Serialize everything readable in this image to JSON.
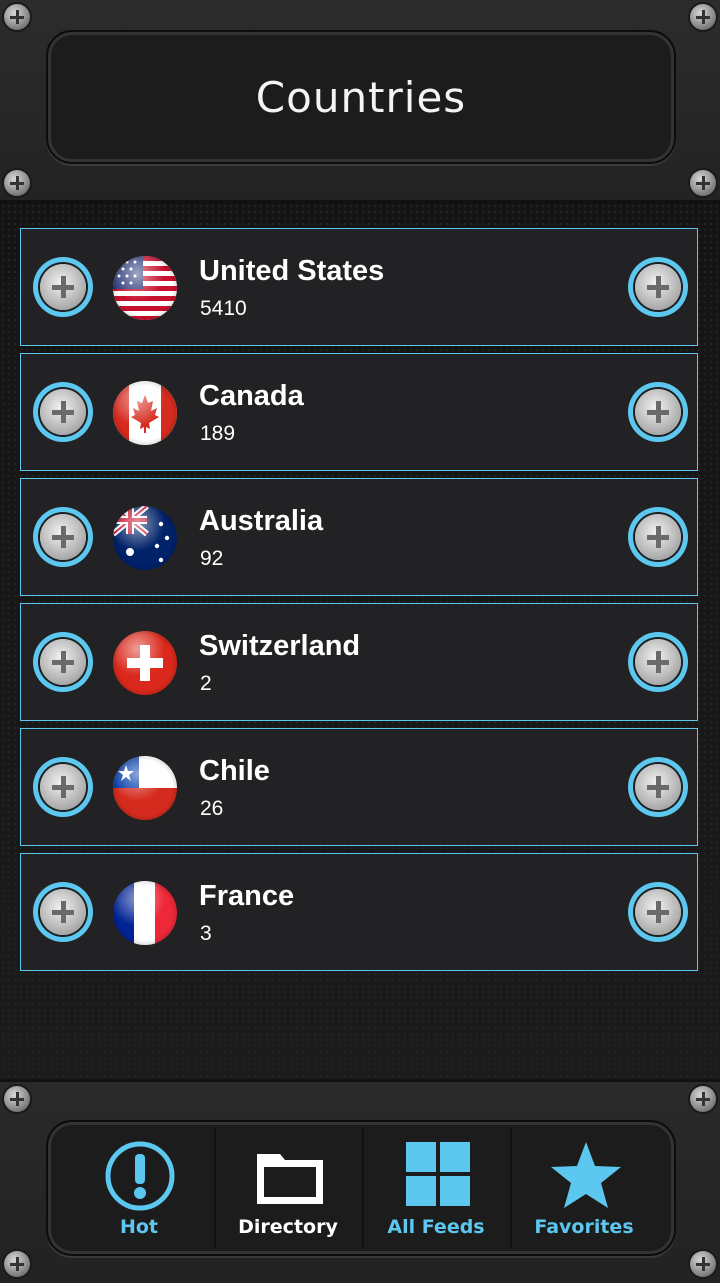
{
  "header": {
    "title": "Countries"
  },
  "accent_color": "#5cc8f0",
  "countries": [
    {
      "name": "United States",
      "count": "5410",
      "flag_icon": "us-flag-icon"
    },
    {
      "name": "Canada",
      "count": "189",
      "flag_icon": "canada-flag-icon"
    },
    {
      "name": "Australia",
      "count": "92",
      "flag_icon": "australia-flag-icon"
    },
    {
      "name": "Switzerland",
      "count": "2",
      "flag_icon": "switzerland-flag-icon"
    },
    {
      "name": "Chile",
      "count": "26",
      "flag_icon": "chile-flag-icon"
    },
    {
      "name": "France",
      "count": "3",
      "flag_icon": "france-flag-icon"
    }
  ],
  "tabs": [
    {
      "label": "Hot",
      "icon": "exclamation-icon",
      "color": "#5cc8f0"
    },
    {
      "label": "Directory",
      "icon": "folder-icon",
      "color": "#ffffff"
    },
    {
      "label": "All Feeds",
      "icon": "grid-icon",
      "color": "#5cc8f0"
    },
    {
      "label": "Favorites",
      "icon": "star-icon",
      "color": "#5cc8f0"
    }
  ]
}
